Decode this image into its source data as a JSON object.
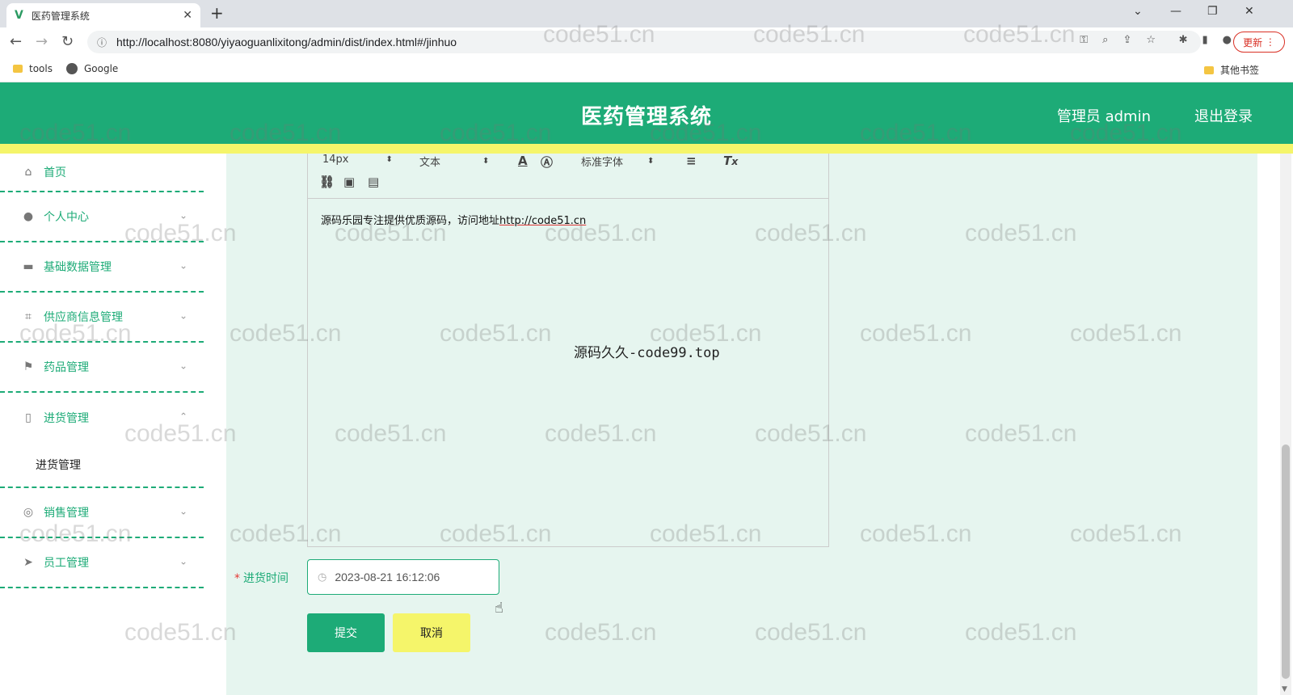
{
  "browser": {
    "tab_title": "医药管理系统",
    "tab_close": "✕",
    "new_tab": "+",
    "url": "http://localhost:8080/yiyaoguanlixitong/admin/dist/index.html#/jinhuo",
    "update_label": "更新",
    "bookmarks": [
      "tools",
      "Google"
    ],
    "other_bookmarks": "其他书签"
  },
  "header": {
    "title": "医药管理系统",
    "admin_label": "管理员 admin",
    "logout_label": "退出登录"
  },
  "sidebar": {
    "items": [
      {
        "label": "首页",
        "icon": "home-icon",
        "glyph": "⌂"
      },
      {
        "label": "个人中心",
        "icon": "user-icon",
        "glyph": "●"
      },
      {
        "label": "基础数据管理",
        "icon": "monitor-icon",
        "glyph": "▬"
      },
      {
        "label": "供应商信息管理",
        "icon": "crop-icon",
        "glyph": "⌗"
      },
      {
        "label": "药品管理",
        "icon": "flag-icon",
        "glyph": "⚑"
      },
      {
        "label": "进货管理",
        "icon": "mobile-icon",
        "glyph": "▯"
      },
      {
        "label": "销售管理",
        "icon": "target-icon",
        "glyph": "◎"
      },
      {
        "label": "员工管理",
        "icon": "send-icon",
        "glyph": "➤"
      }
    ],
    "submenu": {
      "label": "进货管理"
    }
  },
  "editor": {
    "font_size": "14px",
    "block_type": "文本",
    "font_family": "标准字体",
    "content_prefix": "源码乐园专注提供优质源码，访问地址",
    "content_link": "http://code51.cn",
    "overlay_text": "源码久久-code99.top"
  },
  "form": {
    "required_mark": "*",
    "date_label": "进货时间",
    "date_value": "2023-08-21 16:12:06",
    "submit_label": "提交",
    "cancel_label": "取消"
  },
  "watermark": "code51.cn",
  "colors": {
    "primary": "#1dab77",
    "accent_yellow": "#f5f56a",
    "content_bg": "#e6f5ef"
  }
}
